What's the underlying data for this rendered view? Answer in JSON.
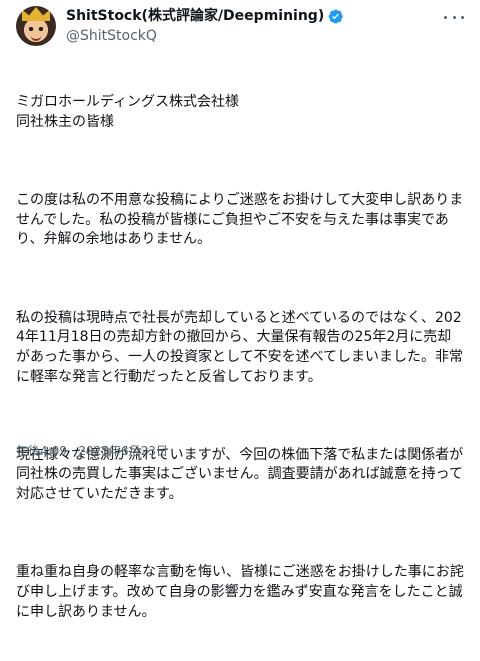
{
  "author": {
    "display_name": "ShitStock(株式評論家/Deepmining)",
    "handle": "@ShitStockQ"
  },
  "icons": {
    "avatar": "avatar-crowned-character",
    "verified": "verified-badge-icon",
    "more": "more-options-icon"
  },
  "colors": {
    "verified": "#1d9bf0",
    "secondary_text": "#536471"
  },
  "tweet": {
    "paragraphs": [
      "ミガロホールディングス株式会社様\n同社株主の皆様",
      "この度は私の不用意な投稿によりご迷惑をお掛けして大変申し訳ありませんでした。私の投稿が皆様にご負担やご不安を与えた事は事実であり、弁解の余地はありません。",
      "私の投稿は現時点で社長が売却していると述べているのではなく、2024年11月18日の売却方針の撤回から、大量保有報告の25年2月に売却があった事から、一人の投資家として不安を述べてしまいました。非常に軽率な発言と行動だったと反省しております。",
      "現在様々な憶測が流れていますが、今回の株価下落で私または関係者が同社株の売買した事実はございません。調査要請があれば誠意を持って対応させていただきます。",
      "重ね重ね自身の軽率な言動を悔い、皆様にご迷惑をお掛けした事にお詫び申し上げます。改めて自身の影響力を鑑みず安直な発言をしたこと誠に申し訳ありません。"
    ],
    "timestamp": "午後4:09 · 2025年6月23日"
  }
}
